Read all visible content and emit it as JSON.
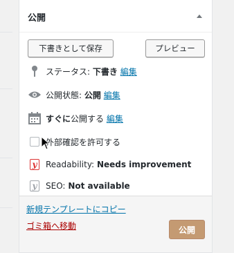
{
  "panel": {
    "title": "公開",
    "save_draft_label": "下書きとして保存",
    "preview_label": "プレビュー",
    "status": {
      "label": "ステータス:",
      "value": "下書き",
      "edit": "編集"
    },
    "visibility": {
      "label": "公開状態:",
      "value": "公開",
      "edit": "編集"
    },
    "schedule": {
      "label_bold": "すぐに",
      "label_rest": "公開する",
      "edit": "編集"
    },
    "external_check": {
      "label": "外部確認を許可する",
      "checked": false
    },
    "readability": {
      "label": "Readability:",
      "value": "Needs improvement",
      "color": "#dc3232"
    },
    "seo": {
      "label": "SEO:",
      "value": "Not available",
      "color": "#72777c"
    },
    "footer": {
      "copy_link": "新規テンプレートにコピー",
      "trash_link": "ゴミ箱へ移動",
      "publish_label": "公開"
    }
  },
  "colors": {
    "accent_link": "#0073aa",
    "danger_link": "#aa0000",
    "publish_button": "#c49a72"
  }
}
